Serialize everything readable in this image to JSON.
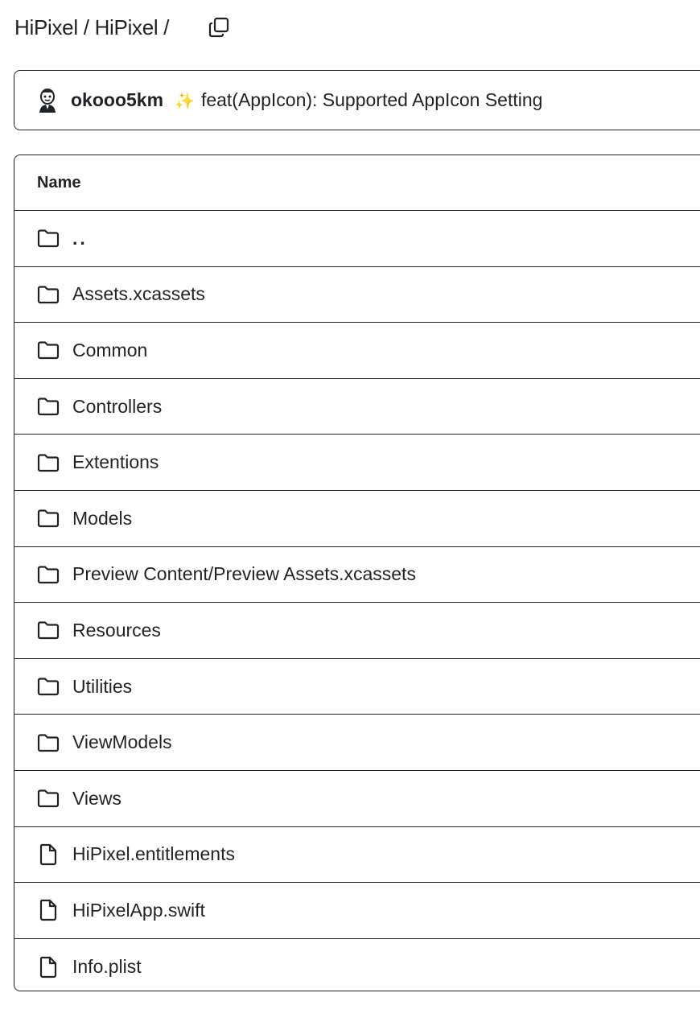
{
  "breadcrumb": {
    "text": "HiPixel / HiPixel /"
  },
  "commit": {
    "author": "okooo5km",
    "sparkle": "✨",
    "message": "feat(AppIcon): Supported AppIcon Setting"
  },
  "table": {
    "header": "Name",
    "rows": [
      {
        "type": "folder",
        "name": ".."
      },
      {
        "type": "folder",
        "name": "Assets.xcassets"
      },
      {
        "type": "folder",
        "name": "Common"
      },
      {
        "type": "folder",
        "name": "Controllers"
      },
      {
        "type": "folder",
        "name": "Extentions"
      },
      {
        "type": "folder",
        "name": "Models"
      },
      {
        "type": "folder",
        "name": "Preview Content/Preview Assets.xcassets"
      },
      {
        "type": "folder",
        "name": "Resources"
      },
      {
        "type": "folder",
        "name": "Utilities"
      },
      {
        "type": "folder",
        "name": "ViewModels"
      },
      {
        "type": "folder",
        "name": "Views"
      },
      {
        "type": "file",
        "name": "HiPixel.entitlements"
      },
      {
        "type": "file",
        "name": "HiPixelApp.swift"
      },
      {
        "type": "file",
        "name": "Info.plist"
      }
    ]
  }
}
